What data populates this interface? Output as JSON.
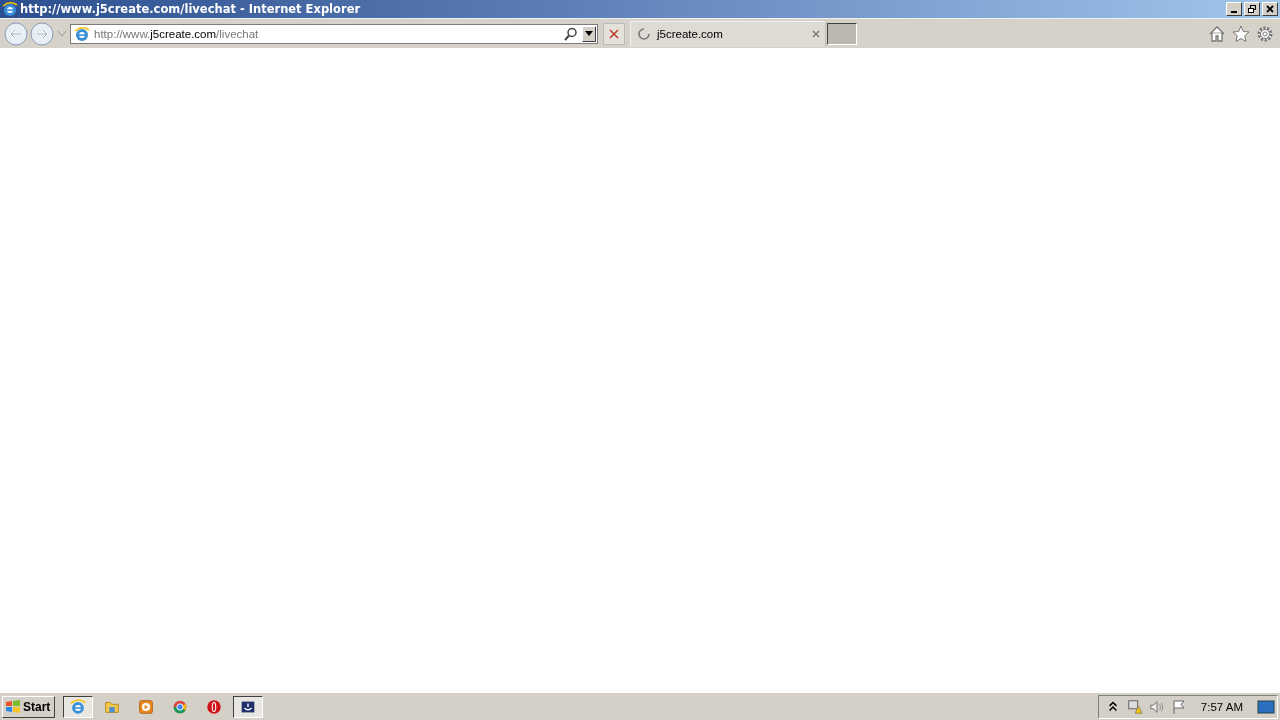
{
  "window": {
    "title": "http://www.j5create.com/livechat - Internet Explorer"
  },
  "address_bar": {
    "url_parts": [
      {
        "text": "http://www.",
        "kind": "dim"
      },
      {
        "text": "j5create.com",
        "kind": "host"
      },
      {
        "text": "/livechat",
        "kind": "dim"
      }
    ]
  },
  "tabs": [
    {
      "label": "j5create.com",
      "selected": true,
      "loading": true
    }
  ],
  "taskbar": {
    "start": "Start",
    "items": [
      {
        "kind": "ie",
        "selected": true
      },
      {
        "kind": "folder",
        "selected": false
      },
      {
        "kind": "media",
        "selected": false
      },
      {
        "kind": "chrome",
        "selected": false
      },
      {
        "kind": "opera",
        "selected": false
      },
      {
        "kind": "app",
        "selected": true
      }
    ],
    "clock": "7:57 AM"
  }
}
